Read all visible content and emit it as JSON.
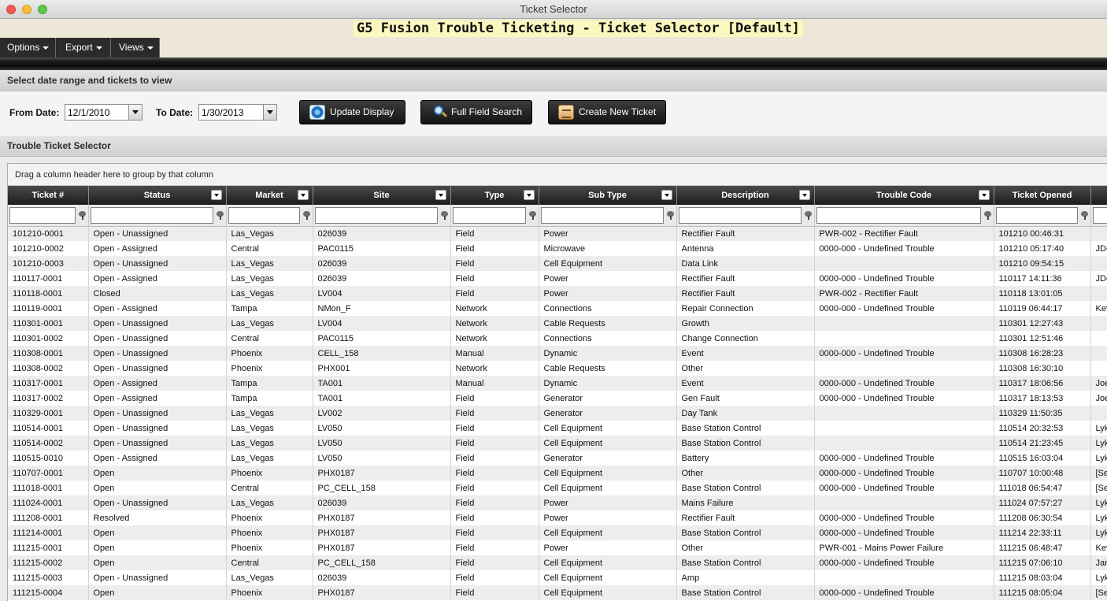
{
  "window": {
    "title": "Ticket Selector"
  },
  "app": {
    "title": "G5 Fusion Trouble Ticketing - Ticket Selector [Default]"
  },
  "menu": [
    {
      "label": "Options"
    },
    {
      "label": "Export"
    },
    {
      "label": "Views"
    }
  ],
  "date_panel": {
    "heading": "Select date range and tickets to view",
    "from_label": "From Date:",
    "from_value": "12/1/2010",
    "to_label": "To Date:",
    "to_value": "1/30/2013",
    "update_button": "Update Display",
    "search_button": "Full Field Search",
    "create_button": "Create New Ticket"
  },
  "selector": {
    "heading": "Trouble Ticket Selector",
    "group_hint": "Drag a column header here to group by that column"
  },
  "columns": [
    "Ticket #",
    "Status",
    "Market",
    "Site",
    "Type",
    "Sub Type",
    "Description",
    "Trouble Code",
    "Ticket Opened",
    ""
  ],
  "rows": [
    [
      "101210-0001",
      "Open - Unassigned",
      "Las_Vegas",
      "026039",
      "Field",
      "Power",
      "Rectifier Fault",
      "PWR-002 - Rectifier Fault",
      "101210 00:46:31",
      ""
    ],
    [
      "101210-0002",
      "Open - Assigned",
      "Central",
      "PAC0115",
      "Field",
      "Microwave",
      "Antenna",
      "0000-000 - Undefined Trouble",
      "101210 05:17:40",
      "JDo"
    ],
    [
      "101210-0003",
      "Open - Unassigned",
      "Las_Vegas",
      "026039",
      "Field",
      "Cell Equipment",
      "Data Link",
      "",
      "101210 09:54:15",
      ""
    ],
    [
      "110117-0001",
      "Open - Assigned",
      "Las_Vegas",
      "026039",
      "Field",
      "Power",
      "Rectifier Fault",
      "0000-000 - Undefined Trouble",
      "110117 14:11:36",
      "JDo"
    ],
    [
      "110118-0001",
      "Closed",
      "Las_Vegas",
      "LV004",
      "Field",
      "Power",
      "Rectifier Fault",
      "PWR-002 - Rectifier Fault",
      "110118 13:01:05",
      ""
    ],
    [
      "110119-0001",
      "Open - Assigned",
      "Tampa",
      "NMon_F",
      "Network",
      "Connections",
      "Repair Connection",
      "0000-000 - Undefined Trouble",
      "110119 06:44:17",
      "Kev"
    ],
    [
      "110301-0001",
      "Open - Unassigned",
      "Las_Vegas",
      "LV004",
      "Network",
      "Cable Requests",
      "Growth",
      "",
      "110301 12:27:43",
      ""
    ],
    [
      "110301-0002",
      "Open - Unassigned",
      "Central",
      "PAC0115",
      "Network",
      "Connections",
      "Change Connection",
      "",
      "110301 12:51:46",
      ""
    ],
    [
      "110308-0001",
      "Open - Unassigned",
      "Phoenix",
      "CELL_158",
      "Manual",
      "Dynamic",
      "Event",
      "0000-000 - Undefined Trouble",
      "110308 16:28:23",
      ""
    ],
    [
      "110308-0002",
      "Open - Unassigned",
      "Phoenix",
      "PHX001",
      "Network",
      "Cable Requests",
      "Other",
      "",
      "110308 16:30:10",
      ""
    ],
    [
      "110317-0001",
      "Open - Assigned",
      "Tampa",
      "TA001",
      "Manual",
      "Dynamic",
      "Event",
      "0000-000 - Undefined Trouble",
      "110317 18:06:56",
      "Joe"
    ],
    [
      "110317-0002",
      "Open - Assigned",
      "Tampa",
      "TA001",
      "Field",
      "Generator",
      "Gen Fault",
      "0000-000 - Undefined Trouble",
      "110317 18:13:53",
      "Joe"
    ],
    [
      "110329-0001",
      "Open - Unassigned",
      "Las_Vegas",
      "LV002",
      "Field",
      "Generator",
      "Day Tank",
      "",
      "110329 11:50:35",
      ""
    ],
    [
      "110514-0001",
      "Open - Unassigned",
      "Las_Vegas",
      "LV050",
      "Field",
      "Cell Equipment",
      "Base Station Control",
      "",
      "110514 20:32:53",
      "Lyk"
    ],
    [
      "110514-0002",
      "Open - Unassigned",
      "Las_Vegas",
      "LV050",
      "Field",
      "Cell Equipment",
      "Base Station Control",
      "",
      "110514 21:23:45",
      "Lyk"
    ],
    [
      "110515-0010",
      "Open - Assigned",
      "Las_Vegas",
      "LV050",
      "Field",
      "Generator",
      "Battery",
      "0000-000 - Undefined Trouble",
      "110515 16:03:04",
      "Lyk"
    ],
    [
      "110707-0001",
      "Open",
      "Phoenix",
      "PHX0187",
      "Field",
      "Cell Equipment",
      "Other",
      "0000-000 - Undefined Trouble",
      "110707 10:00:48",
      "[Se"
    ],
    [
      "111018-0001",
      "Open",
      "Central",
      "PC_CELL_158",
      "Field",
      "Cell Equipment",
      "Base Station Control",
      "0000-000 - Undefined Trouble",
      "111018 06:54:47",
      "[Se"
    ],
    [
      "111024-0001",
      "Open - Unassigned",
      "Las_Vegas",
      "026039",
      "Field",
      "Power",
      "Mains Failure",
      "",
      "111024 07:57:27",
      "Lyk"
    ],
    [
      "111208-0001",
      "Resolved",
      "Phoenix",
      "PHX0187",
      "Field",
      "Power",
      "Rectifier Fault",
      "0000-000 - Undefined Trouble",
      "111208 06:30:54",
      "Lyk"
    ],
    [
      "111214-0001",
      "Open",
      "Phoenix",
      "PHX0187",
      "Field",
      "Cell Equipment",
      "Base Station Control",
      "0000-000 - Undefined Trouble",
      "111214 22:33:11",
      "Lyk"
    ],
    [
      "111215-0001",
      "Open",
      "Phoenix",
      "PHX0187",
      "Field",
      "Power",
      "Other",
      "PWR-001 - Mains Power Failure",
      "111215 06:48:47",
      "Kev"
    ],
    [
      "111215-0002",
      "Open",
      "Central",
      "PC_CELL_158",
      "Field",
      "Cell Equipment",
      "Base Station Control",
      "0000-000 - Undefined Trouble",
      "111215 07:06:10",
      "Jan"
    ],
    [
      "111215-0003",
      "Open - Unassigned",
      "Las_Vegas",
      "026039",
      "Field",
      "Cell Equipment",
      "Amp",
      "",
      "111215 08:03:04",
      "Lyk"
    ],
    [
      "111215-0004",
      "Open",
      "Phoenix",
      "PHX0187",
      "Field",
      "Cell Equipment",
      "Base Station Control",
      "0000-000 - Undefined Trouble",
      "111215 08:05:04",
      "[Se"
    ]
  ],
  "colors": {
    "header_bg": "#1c1c1c",
    "app_band": "#ece7d7",
    "title_highlight": "#fbf7bf"
  }
}
